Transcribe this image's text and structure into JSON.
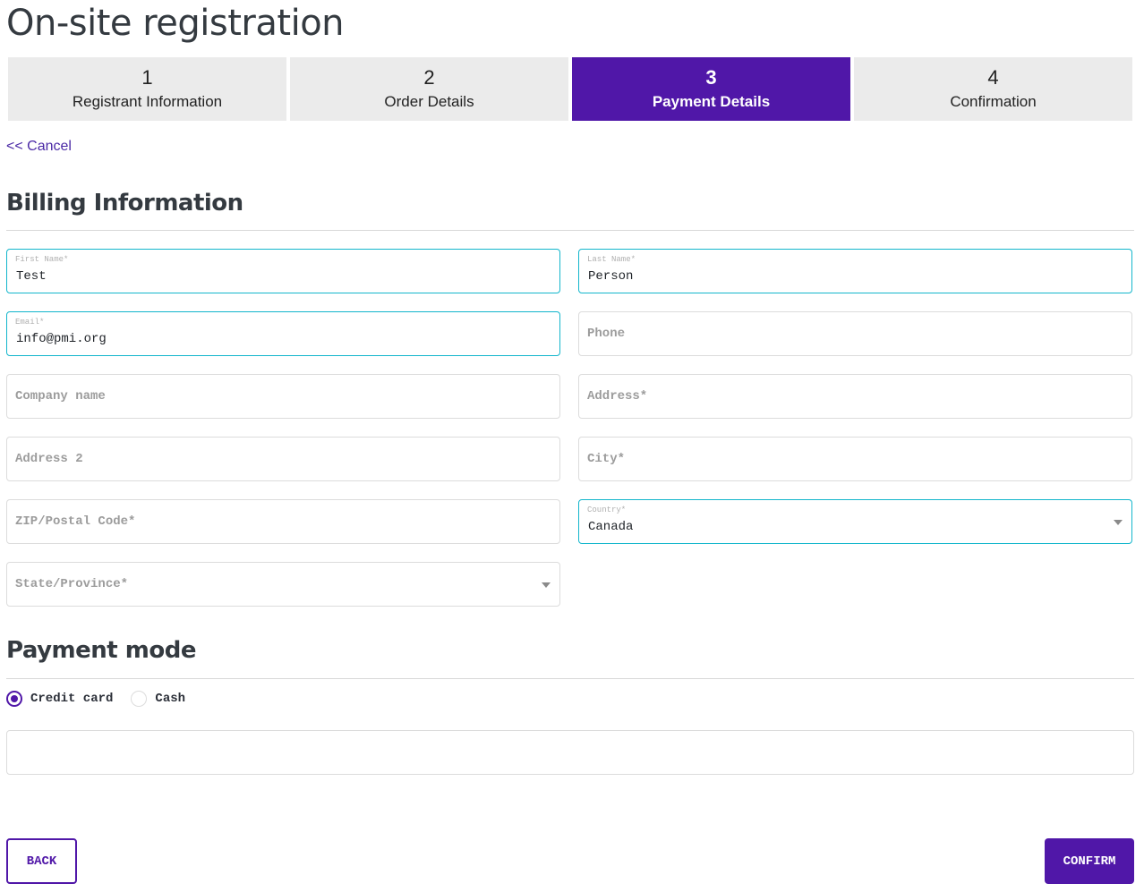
{
  "page": {
    "title": "On-site registration"
  },
  "steps": [
    {
      "number": "1",
      "label": "Registrant Information",
      "active": false
    },
    {
      "number": "2",
      "label": "Order Details",
      "active": false
    },
    {
      "number": "3",
      "label": "Payment Details",
      "active": true
    },
    {
      "number": "4",
      "label": "Confirmation",
      "active": false
    }
  ],
  "cancel": {
    "label": "<< Cancel"
  },
  "billing": {
    "title": "Billing Information",
    "fields": {
      "first_name": {
        "label": "First Name*",
        "value": "Test"
      },
      "last_name": {
        "label": "Last Name*",
        "value": "Person"
      },
      "email": {
        "label": "Email*",
        "value": "info@pmi.org"
      },
      "phone": {
        "placeholder": "Phone"
      },
      "company": {
        "placeholder": "Company name"
      },
      "address": {
        "placeholder": "Address*"
      },
      "address2": {
        "placeholder": "Address 2"
      },
      "city": {
        "placeholder": "City*"
      },
      "zip": {
        "placeholder": "ZIP/Postal Code*"
      },
      "country": {
        "label": "Country*",
        "value": "Canada"
      },
      "state": {
        "placeholder": "State/Province*"
      }
    }
  },
  "payment": {
    "title": "Payment mode",
    "options": [
      {
        "label": "Credit card",
        "checked": true
      },
      {
        "label": "Cash",
        "checked": false
      }
    ]
  },
  "buttons": {
    "back": "BACK",
    "confirm": "CONFIRM"
  },
  "colors": {
    "accent": "#5017a8",
    "focus_border": "#13b6cc",
    "step_inactive": "#ebebeb"
  }
}
